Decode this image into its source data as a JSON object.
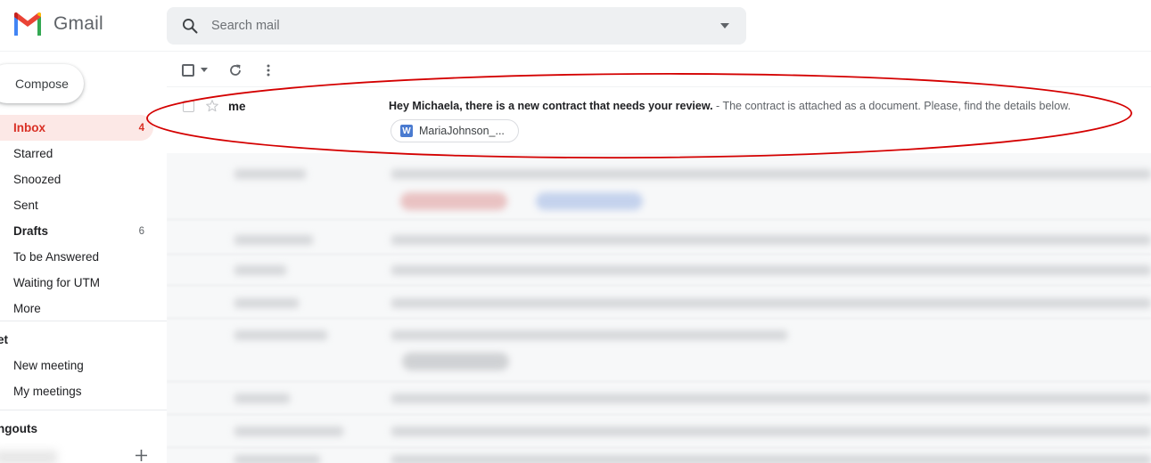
{
  "app": {
    "name": "Gmail"
  },
  "search": {
    "placeholder": "Search mail"
  },
  "sidebar": {
    "compose_label": "Compose",
    "items": [
      {
        "label": "Inbox",
        "count": "4"
      },
      {
        "label": "Starred",
        "count": ""
      },
      {
        "label": "Snoozed",
        "count": ""
      },
      {
        "label": "Sent",
        "count": ""
      },
      {
        "label": "Drafts",
        "count": "6"
      },
      {
        "label": "To be Answered",
        "count": ""
      },
      {
        "label": "Waiting for UTM",
        "count": ""
      },
      {
        "label": "More",
        "count": ""
      }
    ],
    "meet": {
      "title": "et",
      "items": [
        "New meeting",
        "My meetings"
      ]
    },
    "hangouts": {
      "title": "ngouts"
    }
  },
  "email": {
    "sender": "me",
    "subject": "Hey Michaela, there is a new contract that needs your review.",
    "snippet": " - The contract is attached as a document. Please, find the details below.",
    "attachment": {
      "icon": "W",
      "name": "MariaJohnson_..."
    }
  },
  "colors": {
    "accent_red": "#d93025",
    "inbox_highlight": "#fce8e6",
    "annotation_red": "#d40000",
    "word_blue": "#4a7bd0"
  },
  "icons": [
    "gmail-logo",
    "search-icon",
    "dropdown-icon",
    "compose-icon",
    "checkbox-icon",
    "refresh-icon",
    "more-vert-icon",
    "star-icon",
    "word-doc-icon",
    "plus-icon"
  ]
}
